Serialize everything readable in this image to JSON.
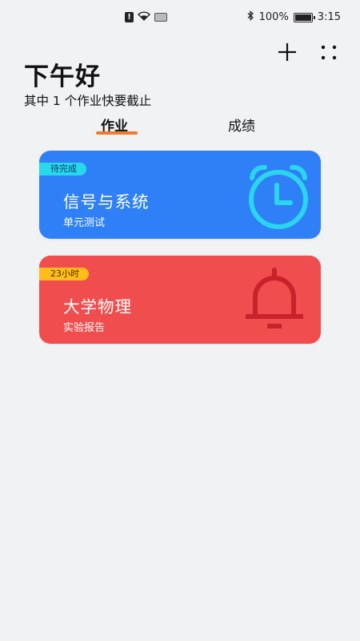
{
  "status_bar": {
    "battery_percent": "100%",
    "time": "3:15",
    "icons": [
      "alert-icon",
      "wifi-icon",
      "data-icon",
      "bluetooth-icon",
      "battery-icon"
    ]
  },
  "header": {
    "greeting": "下午好",
    "summary": "其中 1 个作业快要截止"
  },
  "tabs": [
    {
      "label": "作业",
      "active": true
    },
    {
      "label": "成绩",
      "active": false
    }
  ],
  "assignments": [
    {
      "badge": "待完成",
      "course": "信号与系统",
      "task": "单元测试",
      "icon": "alarm-clock-icon",
      "color": "#2f80f6"
    },
    {
      "badge": "23小时",
      "course": "大学物理",
      "task": "实验报告",
      "icon": "bell-icon",
      "color": "#f04e4e"
    }
  ],
  "colors": {
    "tab_indicator": "#f07b2a",
    "badge_pending": "#28d9ea",
    "badge_deadline": "#ffbe1a",
    "clock_icon": "#2bd5ee",
    "bell_icon": "#c8232a"
  }
}
